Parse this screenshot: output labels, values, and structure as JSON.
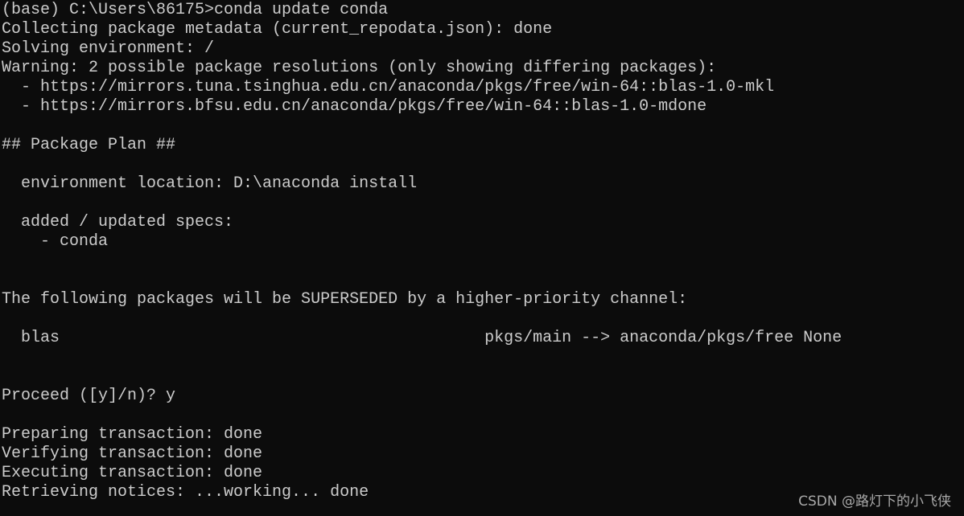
{
  "terminal": {
    "lines": [
      "(base) C:\\Users\\86175>conda update conda",
      "Collecting package metadata (current_repodata.json): done",
      "Solving environment: /",
      "Warning: 2 possible package resolutions (only showing differing packages):",
      "  - https://mirrors.tuna.tsinghua.edu.cn/anaconda/pkgs/free/win-64::blas-1.0-mkl",
      "  - https://mirrors.bfsu.edu.cn/anaconda/pkgs/free/win-64::blas-1.0-mdone",
      "",
      "## Package Plan ##",
      "",
      "  environment location: D:\\anaconda install",
      "",
      "  added / updated specs:",
      "    - conda",
      "",
      "",
      "The following packages will be SUPERSEDED by a higher-priority channel:",
      "",
      "  blas                                            pkgs/main --> anaconda/pkgs/free None",
      "",
      "",
      "Proceed ([y]/n)? y",
      "",
      "Preparing transaction: done",
      "Verifying transaction: done",
      "Executing transaction: done",
      "Retrieving notices: ...working... done"
    ]
  },
  "watermark": "CSDN @路灯下的小飞侠",
  "colors": {
    "background": "#0c0c0c",
    "text": "#cccccc"
  }
}
